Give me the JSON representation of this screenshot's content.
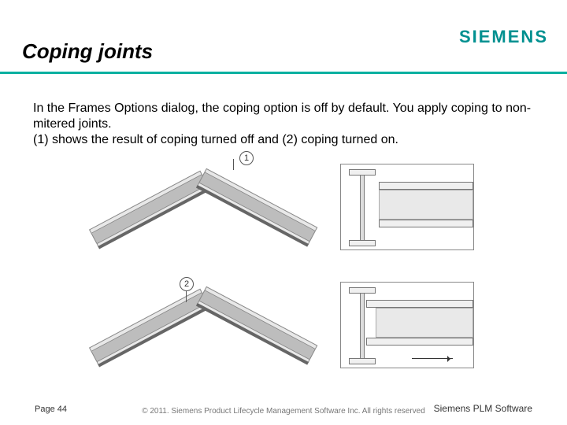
{
  "header": {
    "title": "Coping joints",
    "logo_text": "SIEMENS"
  },
  "body": {
    "paragraph": "In the Frames Options dialog, the coping option is off by default. You apply coping to non-mitered joints.\n(1) shows the result of coping turned off and (2) coping turned on."
  },
  "figure": {
    "callout_1": "1",
    "callout_2": "2"
  },
  "footer": {
    "copyright": "© 2011. Siemens Product Lifecycle Management Software Inc. All rights reserved",
    "page_label": "Page 44",
    "brand": "Siemens PLM Software"
  }
}
